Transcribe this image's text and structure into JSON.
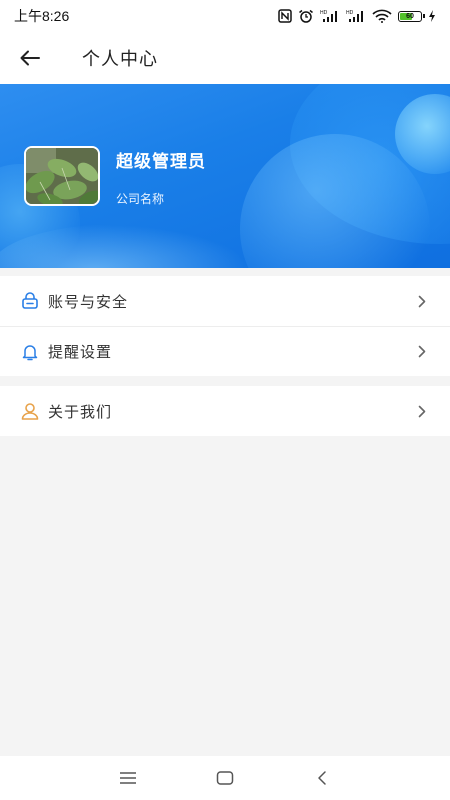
{
  "status_bar": {
    "time": "上午8:26",
    "icons": [
      "nfc-icon",
      "alarm-icon",
      "signal-hd-icon",
      "signal-hd-icon",
      "wifi-icon",
      "battery-icon",
      "charging-icon"
    ],
    "battery_level": "60",
    "battery_fraction": 0.6
  },
  "header": {
    "title": "个人中心",
    "back_icon": "back-arrow-icon"
  },
  "profile": {
    "name": "超级管理员",
    "company": "公司名称"
  },
  "menu": {
    "items": [
      {
        "label": "账号与安全",
        "icon": "lock-icon",
        "icon_color": "#2a7fe6"
      },
      {
        "label": "提醒设置",
        "icon": "bell-icon",
        "icon_color": "#2a7fe6"
      },
      {
        "label": "关于我们",
        "icon": "user-icon",
        "icon_color": "#e8a24a"
      }
    ]
  },
  "colors": {
    "banner": "#1a7fe8",
    "accent": "#2a7fe6",
    "background": "#f4f4f4"
  },
  "nav_bar": {
    "icons": [
      "menu-icon",
      "home-icon",
      "back-icon"
    ]
  }
}
